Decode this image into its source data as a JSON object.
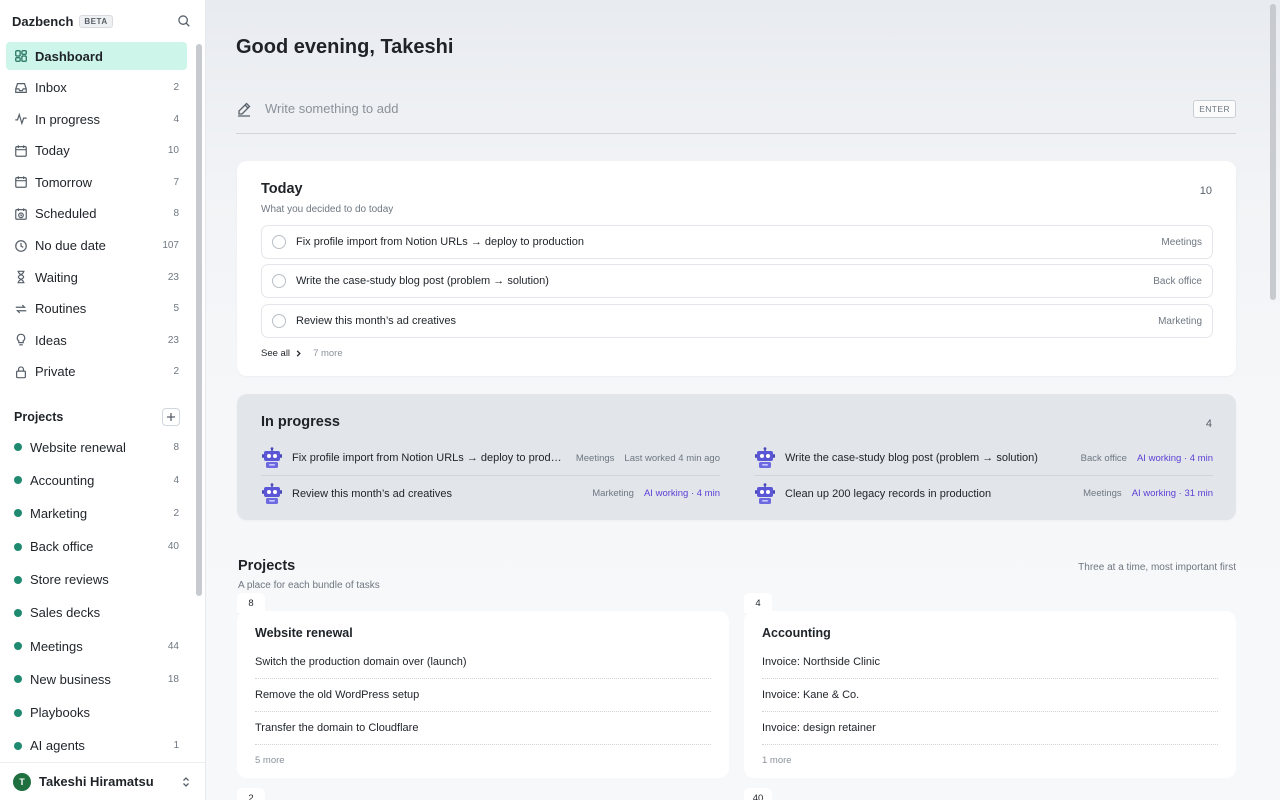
{
  "app": {
    "name": "Dazbench",
    "badge": "BETA"
  },
  "colors": {
    "accent_bg": "#cdf5ea",
    "project_dot": "#1f8a70",
    "ai_status": "#5b3fd4",
    "avatar": "#1f6f3f"
  },
  "nav": [
    {
      "label": "Dashboard",
      "count": "",
      "icon": "dashboard-icon",
      "active": true
    },
    {
      "label": "Inbox",
      "count": "2",
      "icon": "inbox-icon"
    },
    {
      "label": "In progress",
      "count": "4",
      "icon": "activity-icon"
    },
    {
      "label": "Today",
      "count": "10",
      "icon": "calendar-icon"
    },
    {
      "label": "Tomorrow",
      "count": "7",
      "icon": "calendar-icon"
    },
    {
      "label": "Scheduled",
      "count": "8",
      "icon": "calendar-clock-icon"
    },
    {
      "label": "No due date",
      "count": "107",
      "icon": "clock-icon"
    },
    {
      "label": "Waiting",
      "count": "23",
      "icon": "hourglass-icon"
    },
    {
      "label": "Routines",
      "count": "5",
      "icon": "repeat-icon"
    },
    {
      "label": "Ideas",
      "count": "23",
      "icon": "lightbulb-icon"
    },
    {
      "label": "Private",
      "count": "2",
      "icon": "lock-icon"
    }
  ],
  "projects_nav": {
    "heading": "Projects",
    "items": [
      {
        "label": "Website renewal",
        "count": "8"
      },
      {
        "label": "Accounting",
        "count": "4"
      },
      {
        "label": "Marketing",
        "count": "2"
      },
      {
        "label": "Back office",
        "count": "40"
      },
      {
        "label": "Store reviews",
        "count": ""
      },
      {
        "label": "Sales decks",
        "count": ""
      },
      {
        "label": "Meetings",
        "count": "44"
      },
      {
        "label": "New business",
        "count": "18"
      },
      {
        "label": "Playbooks",
        "count": ""
      },
      {
        "label": "AI agents",
        "count": "1"
      }
    ]
  },
  "user": {
    "initial": "T",
    "name": "Takeshi Hiramatsu"
  },
  "main": {
    "greeting": "Good evening, Takeshi",
    "quick_add": {
      "placeholder": "Write something to add",
      "hint": "ENTER"
    },
    "today": {
      "title": "Today",
      "subtitle": "What you decided to do today",
      "count": "10",
      "tasks": [
        {
          "text": "Fix profile import from Notion URLs → deploy to production",
          "tag": "Meetings"
        },
        {
          "text": "Write the case-study blog post (problem → solution)",
          "tag": "Back office"
        },
        {
          "text": "Review this month’s ad creatives",
          "tag": "Marketing"
        }
      ],
      "see_all": "See all",
      "more": "7 more"
    },
    "in_progress": {
      "title": "In progress",
      "count": "4",
      "items": [
        {
          "text": "Fix profile import from Notion URLs → deploy to production",
          "tag": "Meetings",
          "status": "Last worked 4 min ago",
          "ai": false
        },
        {
          "text": "Write the case-study blog post (problem → solution)",
          "tag": "Back office",
          "status": "AI working · 4 min",
          "ai": true
        },
        {
          "text": "Review this month’s ad creatives",
          "tag": "Marketing",
          "status": "AI working · 4 min",
          "ai": true
        },
        {
          "text": "Clean up 200 legacy records in production",
          "tag": "Meetings",
          "status": "AI working · 31 min",
          "ai": true
        }
      ]
    },
    "projects": {
      "title": "Projects",
      "subtitle": "A place for each bundle of tasks",
      "note": "Three at a time, most important first",
      "cards": [
        {
          "count": "8",
          "title": "Website renewal",
          "tasks": [
            "Switch the production domain over (launch)",
            "Remove the old WordPress setup",
            "Transfer the domain to Cloudflare"
          ],
          "more": "5 more"
        },
        {
          "count": "4",
          "title": "Accounting",
          "tasks": [
            "Invoice: Northside Clinic",
            "Invoice: Kane & Co.",
            "Invoice: design retainer"
          ],
          "more": "1 more"
        }
      ],
      "next_counts": [
        "2",
        "40"
      ]
    }
  }
}
